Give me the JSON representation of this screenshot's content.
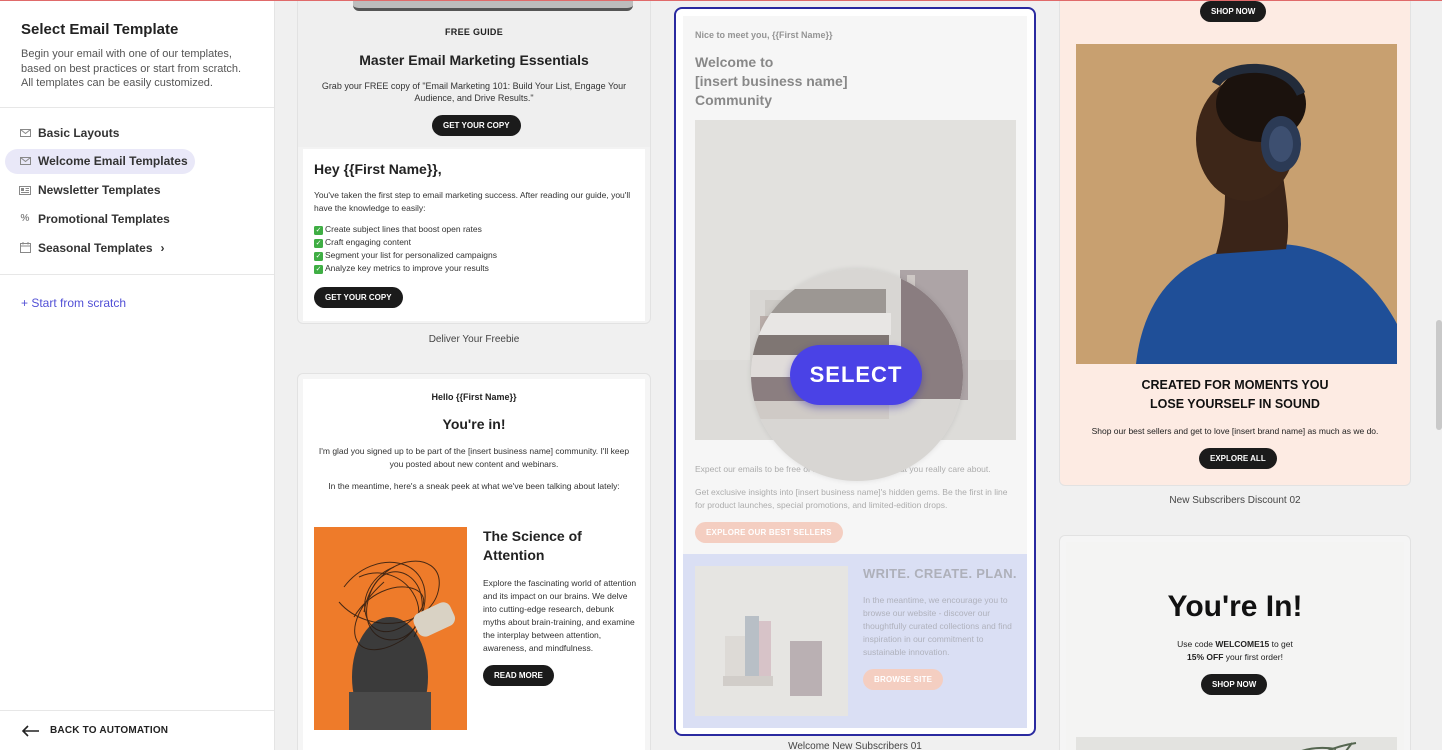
{
  "sidebar": {
    "title": "Select Email Template",
    "description": "Begin your email with one of our templates, based on best practices or start from scratch. All templates can be easily customized.",
    "items": [
      {
        "label": "Basic Layouts",
        "icon": "envelope-icon"
      },
      {
        "label": "Welcome Email Templates",
        "icon": "envelope-icon"
      },
      {
        "label": "Newsletter Templates",
        "icon": "newspaper-icon"
      },
      {
        "label": "Promotional Templates",
        "icon": "percent-icon"
      },
      {
        "label": "Seasonal Templates",
        "icon": "calendar-icon"
      }
    ],
    "start_from_scratch": "+ Start from scratch",
    "back": "BACK TO AUTOMATION"
  },
  "templates": {
    "freebie": {
      "kicker": "FREE GUIDE",
      "title": "Master Email Marketing Essentials",
      "text": "Grab your FREE copy of \"Email Marketing 101: Build Your List, Engage Your Audience, and Drive Results.\"",
      "button": "GET YOUR COPY",
      "greeting": "Hey {{First Name}},",
      "intro": "You've taken the first step to email marketing success. After reading our guide, you'll have the knowledge to easily:",
      "bullets": [
        "Create subject lines that boost open rates",
        "Craft engaging content",
        "Segment your list for personalized campaigns",
        "Analyze key metrics to improve your results"
      ],
      "button2": "GET YOUR COPY",
      "caption": "Deliver Your Freebie"
    },
    "youre_in": {
      "hello": "Hello {{First Name}}",
      "title": "You're in!",
      "text1": "I'm glad you signed up to be part of the [insert business name] community. I'll keep you posted about new content and webinars.",
      "text2": "In the meantime, here's a sneak peek at what we've been talking about lately:",
      "article_title": "The Science of Attention",
      "article_text": "Explore the fascinating world of attention and its impact on our brains. We delve into cutting-edge research, debunk myths about brain-training, and examine the interplay between attention, awareness, and mindfulness.",
      "button": "READ MORE"
    },
    "welcome": {
      "kicker": "Nice to meet you, {{First Name}}",
      "title_lines": [
        "Welcome to",
        "[insert business name]",
        "Community"
      ],
      "expect": "Expect our emails to be free of fluff and focused on what you really care about.",
      "exclusive": "Get exclusive insights into [insert business name]'s hidden gems. Be the first in line for product launches, special promotions, and limited-edition drops.",
      "button": "EXPLORE OUR BEST SELLERS",
      "section_title": "WRITE. CREATE. PLAN.",
      "section_text": "In the meantime, we encourage you to browse our website - discover our thoughtfully curated collections and find inspiration in our commitment to sustainable innovation.",
      "button2": "BROWSE SITE",
      "select": "SELECT",
      "caption": "Welcome New Subscribers 01"
    },
    "discount": {
      "top_button": "SHOP NOW",
      "headline_lines": [
        "CREATED FOR MOMENTS YOU",
        "LOSE YOURSELF IN SOUND"
      ],
      "text": "Shop our best sellers and get to love [insert brand name] as much as we do.",
      "button": "EXPLORE ALL",
      "caption": "New Subscribers Discount 02"
    },
    "youre_in_2": {
      "title": "You're In!",
      "code_prefix": "Use code ",
      "code": "WELCOME15",
      "code_suffix": " to get",
      "offer": "15% OFF",
      "offer_suffix": " your first order!",
      "button": "SHOP NOW"
    }
  },
  "colors": {
    "accent": "#5250d6",
    "selected_border": "#2a2aa0",
    "select_button": "#4a42e6",
    "salmon": "#f0b9a6",
    "peach_bg": "#fdebe3",
    "orange": "#ee7b2a"
  }
}
